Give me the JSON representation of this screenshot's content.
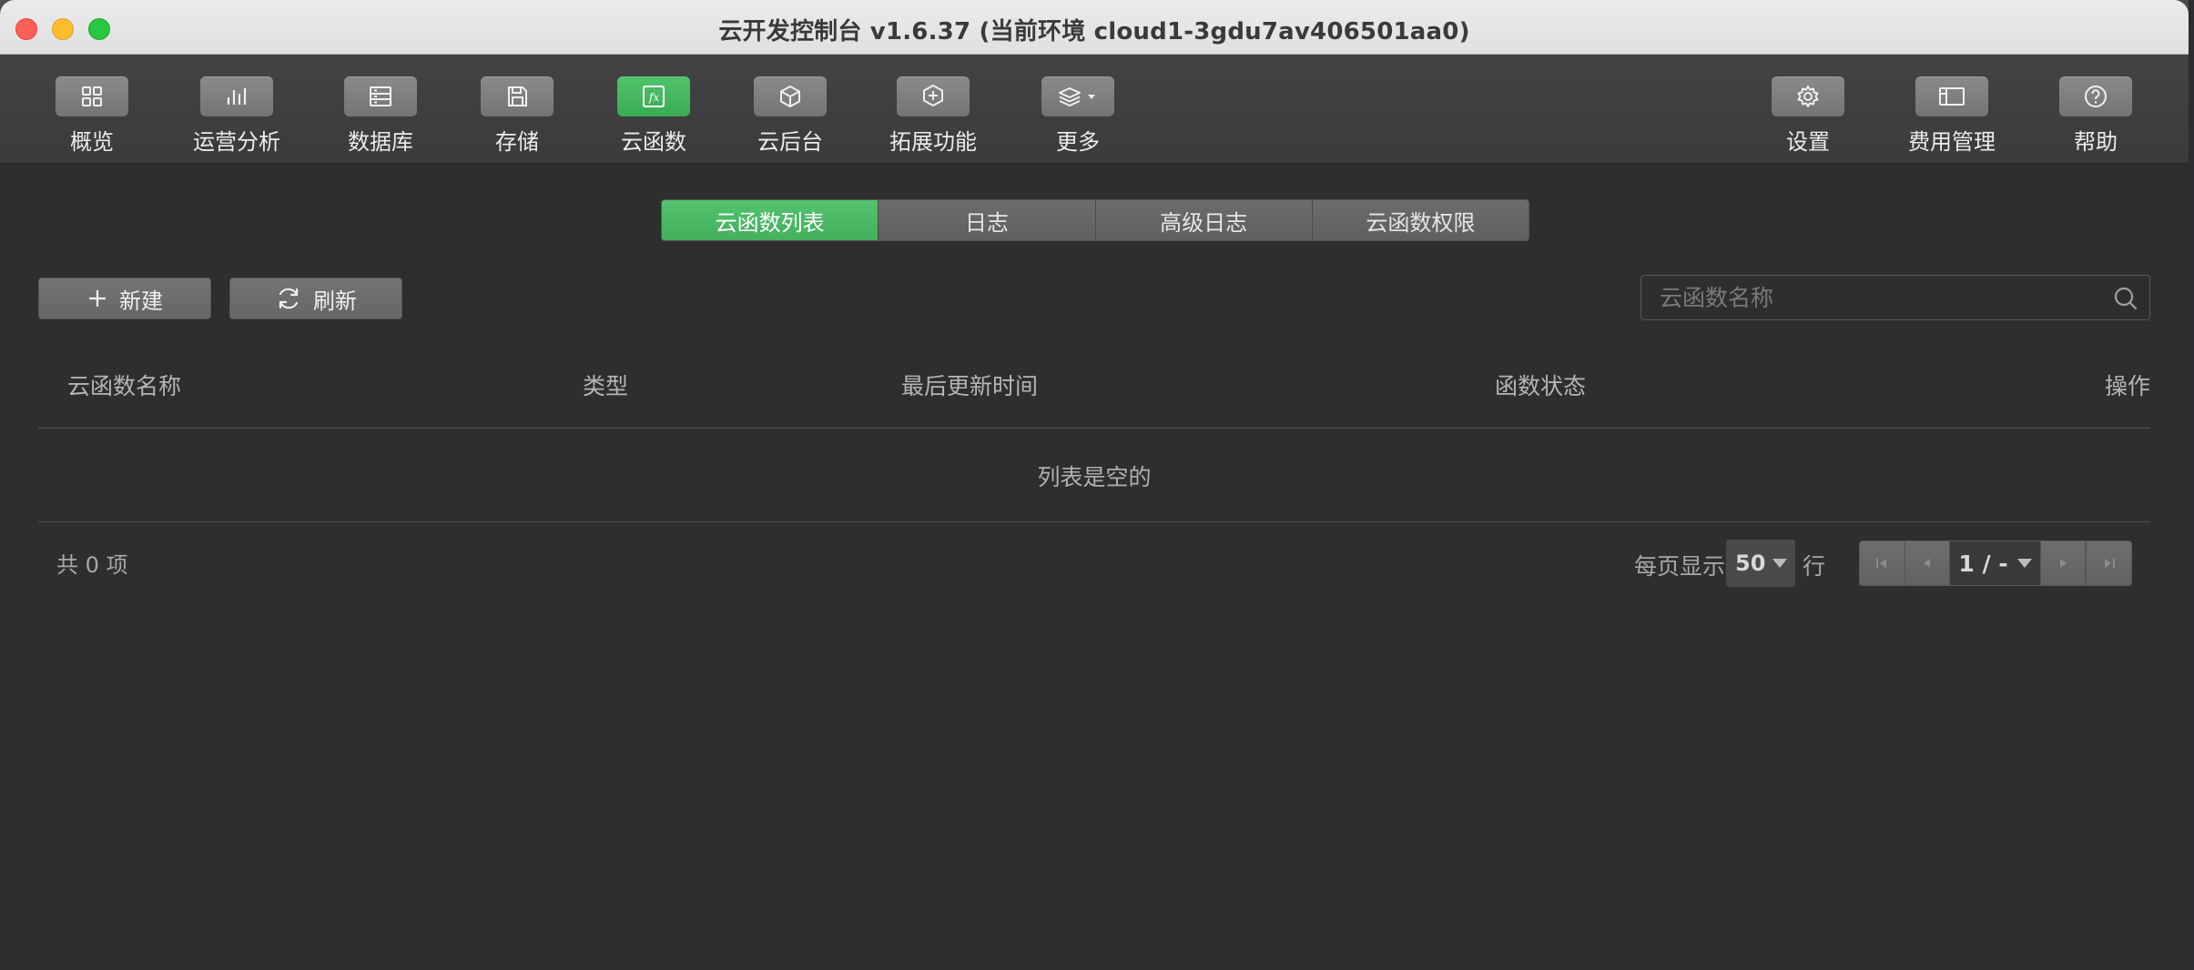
{
  "window": {
    "title": "云开发控制台 v1.6.37 (当前环境 cloud1-3gdu7av406501aa0)"
  },
  "toolbar": {
    "items": [
      {
        "label": "概览",
        "icon": "grid-icon"
      },
      {
        "label": "运营分析",
        "icon": "bar-chart-icon"
      },
      {
        "label": "数据库",
        "icon": "database-icon"
      },
      {
        "label": "存储",
        "icon": "save-icon"
      },
      {
        "label": "云函数",
        "icon": "function-icon",
        "active": true
      },
      {
        "label": "云后台",
        "icon": "cube-icon"
      },
      {
        "label": "拓展功能",
        "icon": "extension-icon"
      },
      {
        "label": "更多",
        "icon": "layers-icon"
      }
    ],
    "right_items": [
      {
        "label": "设置",
        "icon": "gear-icon"
      },
      {
        "label": "费用管理",
        "icon": "billing-icon"
      },
      {
        "label": "帮助",
        "icon": "help-icon"
      }
    ],
    "accent_color": "#43b05d"
  },
  "tabs": [
    "云函数列表",
    "日志",
    "高级日志",
    "云函数权限"
  ],
  "actions": {
    "new_label": "新建",
    "refresh_label": "刷新"
  },
  "search": {
    "placeholder": "云函数名称",
    "value": ""
  },
  "table": {
    "columns": [
      "云函数名称",
      "类型",
      "最后更新时间",
      "函数状态",
      "操作"
    ],
    "rows": [],
    "empty_text": "列表是空的"
  },
  "footer": {
    "total": "共 0 项",
    "page_size_label": "每页显示",
    "page_size": "50",
    "rows_label": "行",
    "page_indicator": "1 / -"
  }
}
